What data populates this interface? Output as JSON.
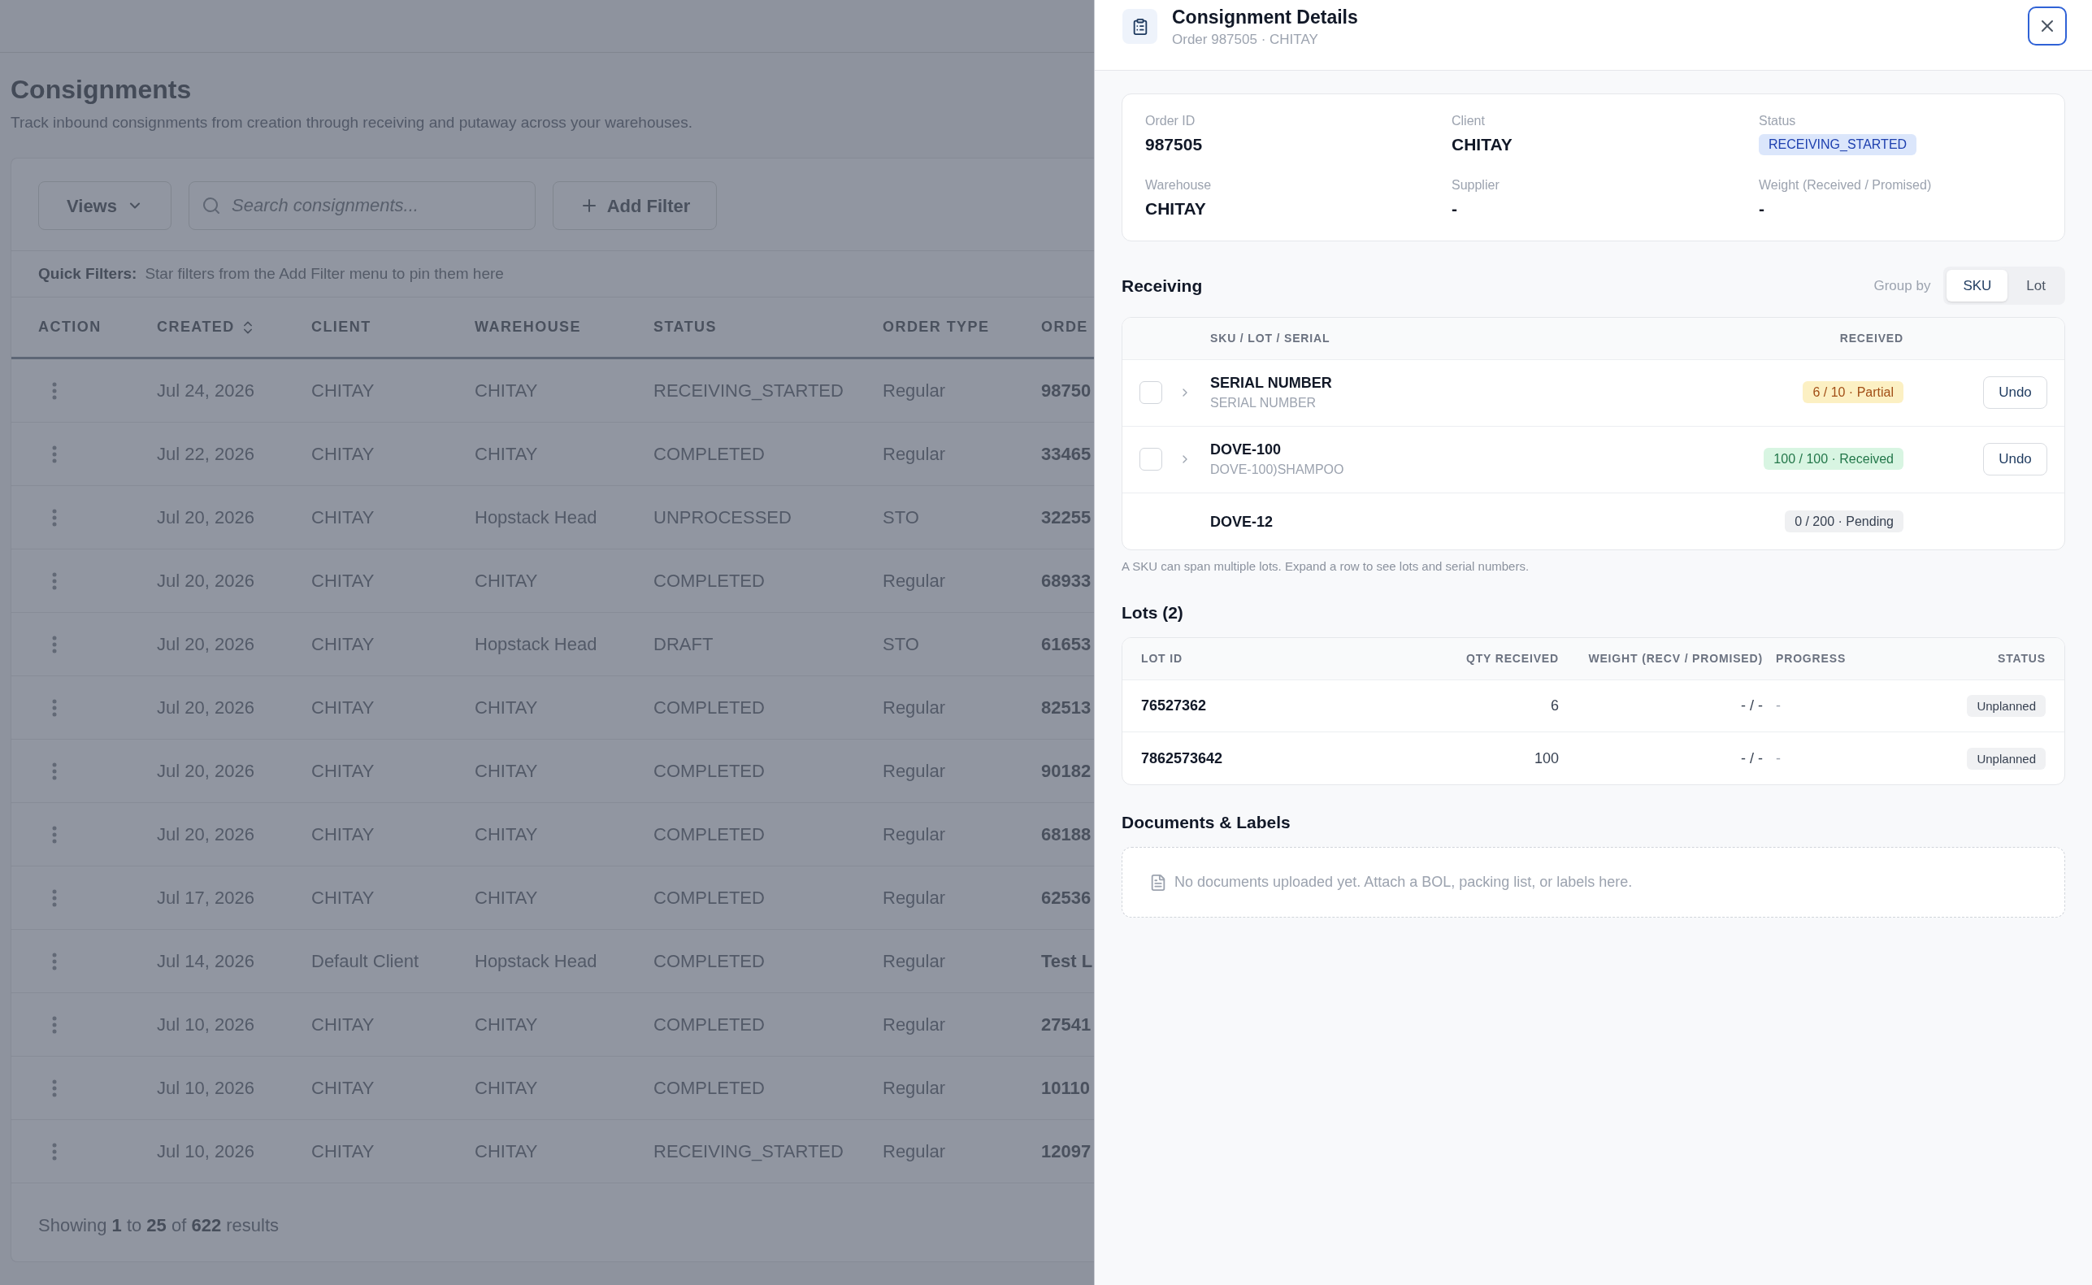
{
  "page": {
    "title": "Consignments",
    "subtitle": "Track inbound consignments from creation through receiving and putaway across your warehouses."
  },
  "toolbar": {
    "views_button": "Views",
    "search": {
      "placeholder": "Search consignments..."
    },
    "add_filter_button": "Add Filter"
  },
  "quick_filters": {
    "label": "Quick Filters:",
    "hint": "Star filters from the Add Filter menu to pin them here"
  },
  "table": {
    "columns": [
      {
        "label": "ACTION",
        "sortable": false
      },
      {
        "label": "CREATED",
        "sortable": true
      },
      {
        "label": "CLIENT",
        "sortable": false
      },
      {
        "label": "WAREHOUSE",
        "sortable": false
      },
      {
        "label": "STATUS",
        "sortable": false
      },
      {
        "label": "ORDER TYPE",
        "sortable": false
      },
      {
        "label": "ORDE",
        "sortable": false
      }
    ],
    "rows": [
      {
        "created": "Jul 24, 2026",
        "client": "CHITAY",
        "warehouse": "CHITAY",
        "status": "RECEIVING_STARTED",
        "order_type": "Regular",
        "column_7": "98750"
      },
      {
        "created": "Jul 22, 2026",
        "client": "CHITAY",
        "warehouse": "CHITAY",
        "status": "COMPLETED",
        "order_type": "Regular",
        "column_7": "33465"
      },
      {
        "created": "Jul 20, 2026",
        "client": "CHITAY",
        "warehouse": "Hopstack Head",
        "status": "UNPROCESSED",
        "order_type": "STO",
        "column_7": "32255"
      },
      {
        "created": "Jul 20, 2026",
        "client": "CHITAY",
        "warehouse": "CHITAY",
        "status": "COMPLETED",
        "order_type": "Regular",
        "column_7": "68933"
      },
      {
        "created": "Jul 20, 2026",
        "client": "CHITAY",
        "warehouse": "Hopstack Head",
        "status": "DRAFT",
        "order_type": "STO",
        "column_7": "61653"
      },
      {
        "created": "Jul 20, 2026",
        "client": "CHITAY",
        "warehouse": "CHITAY",
        "status": "COMPLETED",
        "order_type": "Regular",
        "column_7": "82513"
      },
      {
        "created": "Jul 20, 2026",
        "client": "CHITAY",
        "warehouse": "CHITAY",
        "status": "COMPLETED",
        "order_type": "Regular",
        "column_7": "90182"
      },
      {
        "created": "Jul 20, 2026",
        "client": "CHITAY",
        "warehouse": "CHITAY",
        "status": "COMPLETED",
        "order_type": "Regular",
        "column_7": "68188"
      },
      {
        "created": "Jul 17, 2026",
        "client": "CHITAY",
        "warehouse": "CHITAY",
        "status": "COMPLETED",
        "order_type": "Regular",
        "column_7": "62536"
      },
      {
        "created": "Jul 14, 2026",
        "client": "Default Client",
        "warehouse": "Hopstack Head",
        "status": "COMPLETED",
        "order_type": "Regular",
        "column_7": "Test L"
      },
      {
        "created": "Jul 10, 2026",
        "client": "CHITAY",
        "warehouse": "CHITAY",
        "status": "COMPLETED",
        "order_type": "Regular",
        "column_7": "27541"
      },
      {
        "created": "Jul 10, 2026",
        "client": "CHITAY",
        "warehouse": "CHITAY",
        "status": "COMPLETED",
        "order_type": "Regular",
        "column_7": "10110"
      },
      {
        "created": "Jul 10, 2026",
        "client": "CHITAY",
        "warehouse": "CHITAY",
        "status": "RECEIVING_STARTED",
        "order_type": "Regular",
        "column_7": "12097"
      }
    ]
  },
  "footer": {
    "summary": "Showing **1** to **25** of **622** results"
  },
  "detail_panel": {
    "title": "Consignment Details",
    "subtitle": "Order 987505 · CHITAY",
    "fields": [
      {
        "label": "Order ID",
        "value": "987505",
        "kind": "text"
      },
      {
        "label": "Client",
        "value": "CHITAY",
        "kind": "text"
      },
      {
        "label": "Status",
        "value": "RECEIVING_STARTED",
        "kind": "badge"
      },
      {
        "label": "Warehouse",
        "value": "CHITAY",
        "kind": "text"
      },
      {
        "label": "Supplier",
        "value": "-",
        "kind": "text"
      },
      {
        "label": "Weight (Received / Promised)",
        "value": "-",
        "kind": "text"
      }
    ],
    "receiving": {
      "title": "Receiving",
      "group_by_label": "Group by",
      "group_by_options": [
        {
          "label": "SKU",
          "selected": true
        },
        {
          "label": "Lot",
          "selected": false
        }
      ],
      "columns": [
        "SKU / LOT / SERIAL",
        "RECEIVED"
      ],
      "rows": [
        {
          "kind": "partial",
          "checked": false,
          "expanded": false,
          "name": "SERIAL NUMBER",
          "description": "SERIAL NUMBER",
          "received": "6 / 10 · Partial",
          "undo": "Undo"
        },
        {
          "kind": "received",
          "checked": false,
          "expanded": false,
          "name": "DOVE-100",
          "description": "DOVE-100)SHAMPOO",
          "received": "100 / 100 · Received",
          "undo": "Undo"
        },
        {
          "kind": "pending",
          "name": "DOVE-12",
          "received": "0 / 200 · Pending"
        }
      ],
      "note": "A SKU can span multiple lots. Expand a row to see lots and serial numbers."
    },
    "lots": {
      "title": "Lots (2)",
      "columns": [
        "LOT ID",
        "QTY RECEIVED",
        "WEIGHT (RECV / PROMISED)",
        "PROGRESS",
        "STATUS"
      ],
      "rows": [
        {
          "lot_id": "76527362",
          "qty_received": "6",
          "weight": "- / -",
          "progress": "-",
          "status": "Unplanned"
        },
        {
          "lot_id": "7862573642",
          "qty_received": "100",
          "weight": "- / -",
          "progress": "-",
          "status": "Unplanned"
        }
      ]
    },
    "documents": {
      "title": "Documents & Labels",
      "empty_text": "No documents uploaded yet. Attach a BOL, packing list, or labels here."
    }
  }
}
